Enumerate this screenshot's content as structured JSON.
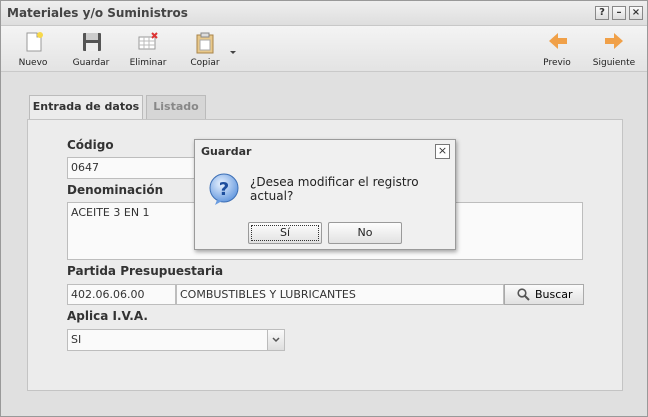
{
  "window": {
    "title": "Materiales y/o Suministros",
    "controls": [
      "?",
      "–",
      "×"
    ]
  },
  "toolbar": {
    "nuevo": "Nuevo",
    "guardar": "Guardar",
    "eliminar": "Eliminar",
    "copiar": "Copiar",
    "previo": "Previo",
    "siguiente": "Siguiente"
  },
  "tabs": {
    "entrada": "Entrada de datos",
    "listado": "Listado"
  },
  "form": {
    "codigo_label": "Código",
    "codigo_value": "0647",
    "denominacion_label": "Denominación",
    "denominacion_value": "ACEITE 3 EN 1",
    "partida_label": "Partida Presupuestaria",
    "partida_code": "402.06.06.00",
    "partida_desc": "COMBUSTIBLES Y LUBRICANTES",
    "buscar_label": "Buscar",
    "iva_label": "Aplica I.V.A.",
    "iva_value": "SI"
  },
  "dialog": {
    "title": "Guardar",
    "message": "¿Desea modificar el registro actual?",
    "yes": "Sí",
    "no": "No",
    "close": "×"
  },
  "colors": {
    "accent_orange": "#f0a048",
    "question_blue": "#2a6fd0"
  }
}
